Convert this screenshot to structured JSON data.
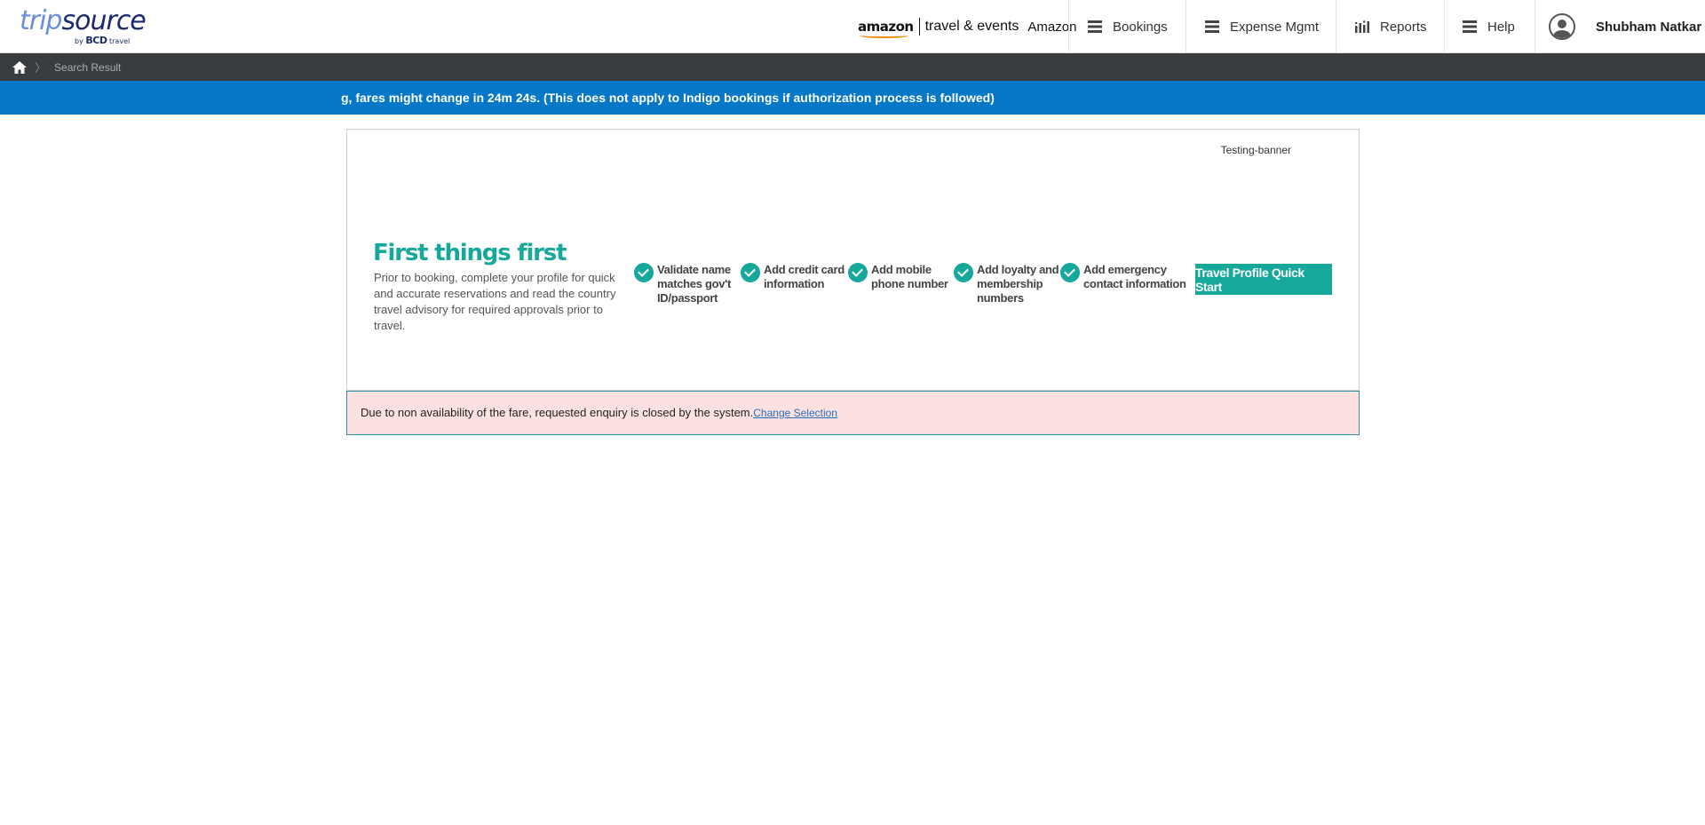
{
  "header": {
    "logo": {
      "trip": "trip",
      "source": "source",
      "sub_by": "by",
      "sub_brand": "BCD",
      "sub_travel": "travel"
    },
    "brand": {
      "amazon": "amazon",
      "travel_events": "travel & events",
      "company": "Amazon"
    },
    "nav": [
      {
        "label": "Bookings",
        "icon": "menu-icon"
      },
      {
        "label": "Expense Mgmt",
        "icon": "menu-icon"
      },
      {
        "label": "Reports",
        "icon": "bar-chart-icon"
      },
      {
        "label": "Help",
        "icon": "menu-icon"
      }
    ],
    "user": {
      "name": "Shubham Natkar",
      "icon": "user-avatar-icon"
    }
  },
  "breadcrumb": {
    "home_icon": "home-icon",
    "current": "Search Result"
  },
  "ticker": {
    "prefix": "g, fares might change in ",
    "timer": "24m 24s.",
    "suffix": " (This does not apply to Indigo bookings if authorization process is followed)"
  },
  "banner": {
    "label": "Testing-banner",
    "title": "First things first",
    "description": "Prior to booking, complete your profile for quick and accurate reservations and read the country travel advisory for required approvals prior to travel.",
    "steps": [
      {
        "line1": "Validate name",
        "line2": "matches gov't",
        "line3": "ID/passport"
      },
      {
        "line1": "Add credit card",
        "line2": "information",
        "line3": ""
      },
      {
        "line1": "Add mobile",
        "line2": "phone number",
        "line3": ""
      },
      {
        "line1": "Add loyalty and",
        "line2": "membership",
        "line3": "numbers"
      },
      {
        "line1": "Add emergency",
        "line2": "contact information",
        "line3": ""
      }
    ],
    "button": "Travel Profile Quick Start"
  },
  "alert": {
    "message": "Due to non availability of the fare, requested enquiry is closed by the system.",
    "link": "Change Selection"
  },
  "colors": {
    "accent_blue": "#0777c8",
    "teal": "#16a89a",
    "alert_bg": "#fde1e1",
    "breadcrumb_bg": "#3a3d3f"
  }
}
